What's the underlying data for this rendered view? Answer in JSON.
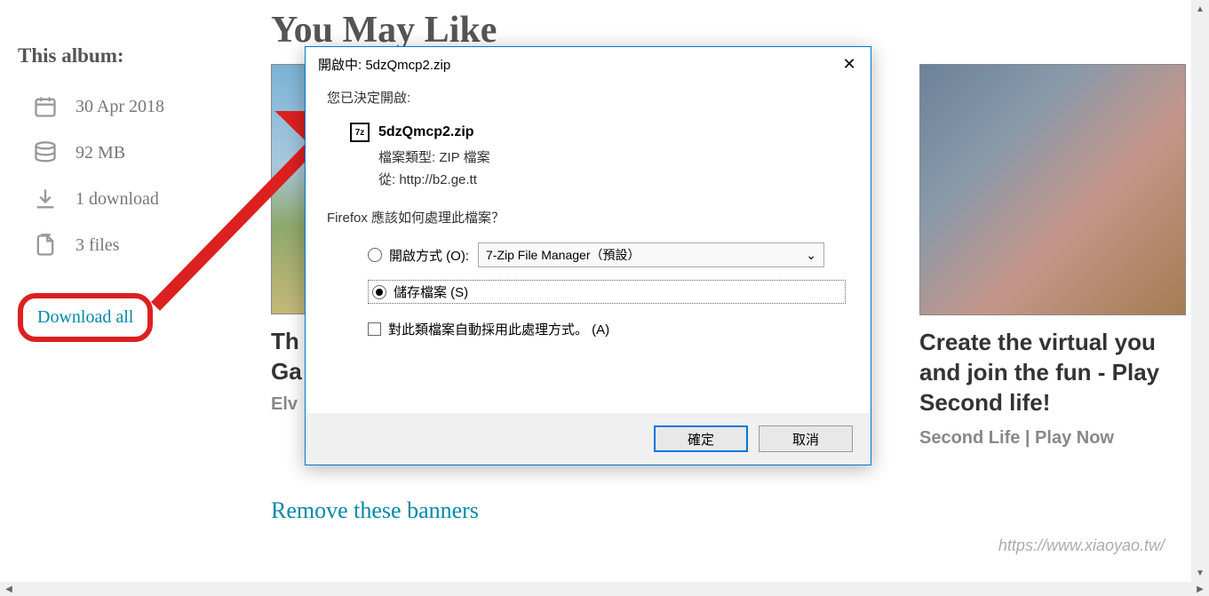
{
  "sidebar": {
    "title": "This album:",
    "date": "30 Apr 2018",
    "size": "92 MB",
    "downloads": "1 download",
    "files": "3 files",
    "download_all": "Download all"
  },
  "heading": "You May Like",
  "card_left": {
    "title_line1": "Th",
    "title_line2": "Ga",
    "subtitle": "Elv"
  },
  "card_right": {
    "title": "Create the virtual you and join the fun - Play Second life!",
    "subtitle": "Second Life | Play Now"
  },
  "remove_banners": "Remove these banners",
  "watermark": "https://www.xiaoyao.tw/",
  "dialog": {
    "title": "開啟中: 5dzQmcp2.zip",
    "opened_label": "您已決定開啟:",
    "filename": "5dzQmcp2.zip",
    "filetype_label": "檔案類型: ZIP 檔案",
    "from_label": "從: http://b2.ge.tt",
    "question": "Firefox 應該如何處理此檔案？",
    "open_with": "開啟方式 (O):",
    "select_value": "7-Zip File Manager（預設）",
    "save_file": "儲存檔案 (S)",
    "remember": "對此類檔案自動採用此處理方式。 (A)",
    "ok": "確定",
    "cancel": "取消"
  }
}
